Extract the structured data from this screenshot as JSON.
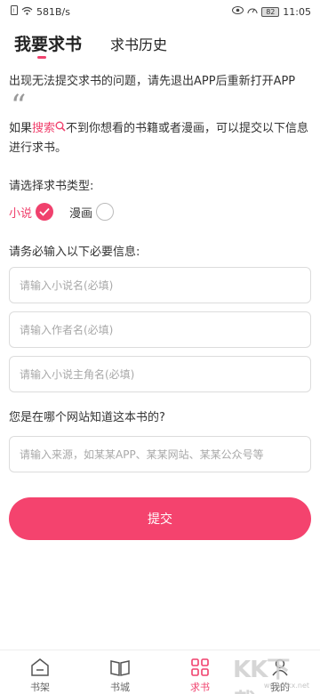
{
  "status": {
    "speed": "581B/s",
    "battery": "82",
    "time": "11:05"
  },
  "header": {
    "tabs": [
      "我要求书",
      "求书历史"
    ]
  },
  "notice": "出现无法提交求书的问题，请先退出APP后重新打开APP",
  "intro": {
    "prefix": "如果",
    "accent": "搜索",
    "suffix": "不到你想看的书籍或者漫画，可以提交以下信息进行求书。"
  },
  "type_section": {
    "label": "请选择求书类型:",
    "options": [
      {
        "label": "小说",
        "checked": true
      },
      {
        "label": "漫画",
        "checked": false
      }
    ]
  },
  "required_section": {
    "label": "请务必输入以下必要信息:",
    "fields": [
      {
        "placeholder": "请输入小说名(必填)"
      },
      {
        "placeholder": "请输入作者名(必填)"
      },
      {
        "placeholder": "请输入小说主角名(必填)"
      }
    ]
  },
  "source_section": {
    "label": "您是在哪个网站知道这本书的?",
    "placeholder": "请输入来源，如某某APP、某某网站、某某公众号等"
  },
  "submit_label": "提交",
  "nav": [
    {
      "label": "书架",
      "icon": "bookshelf-icon"
    },
    {
      "label": "书城",
      "icon": "open-book-icon"
    },
    {
      "label": "求书",
      "icon": "grid-icon",
      "active": true
    },
    {
      "label": "我的",
      "icon": "user-icon"
    }
  ],
  "watermark": {
    "big": "KK下载",
    "small": "www.kkx.net"
  },
  "colors": {
    "accent": "#f0416d",
    "button": "#f4436e"
  }
}
